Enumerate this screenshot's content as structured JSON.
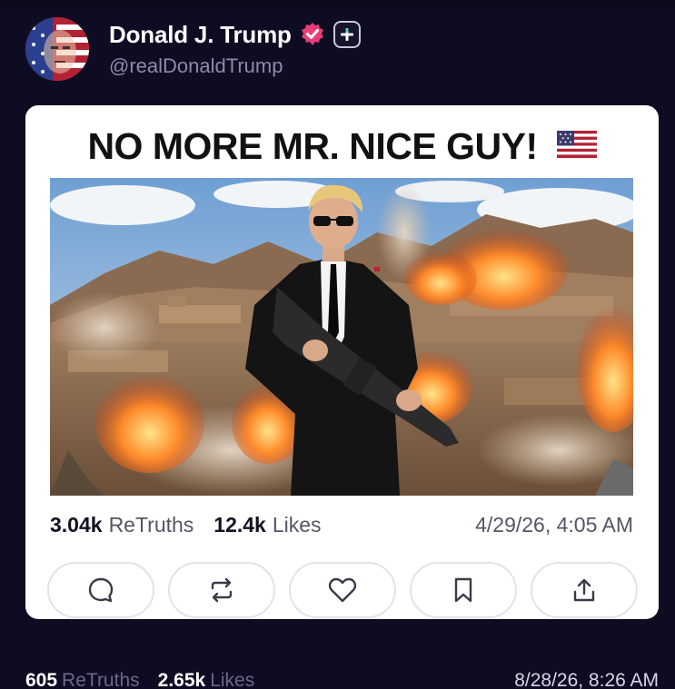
{
  "author": {
    "display_name": "Donald J. Trump",
    "handle": "@realDonaldTrump",
    "avatar_icon": "flag-face-avatar",
    "verified_icon": "verified-badge-icon",
    "follow_icon": "plus-icon"
  },
  "post": {
    "headline": "NO MORE MR. NICE GUY!",
    "headline_emoji": "us-flag-icon",
    "image_icon": "post-image",
    "retruths_count": "3.04k",
    "retruths_label": "ReTruths",
    "likes_count": "12.4k",
    "likes_label": "Likes",
    "timestamp": "4/29/26, 4:05 AM"
  },
  "actions": [
    {
      "name": "reply",
      "icon": "comment-icon"
    },
    {
      "name": "retruth",
      "icon": "repost-icon"
    },
    {
      "name": "like",
      "icon": "heart-icon"
    },
    {
      "name": "bookmark",
      "icon": "bookmark-icon"
    },
    {
      "name": "share",
      "icon": "share-icon"
    }
  ],
  "next_post": {
    "retruths_count": "605",
    "retruths_label": "ReTruths",
    "likes_count": "2.65k",
    "likes_label": "Likes",
    "timestamp": "8/28/26, 8:26 AM"
  },
  "colors": {
    "background": "#0d0c22",
    "card": "#ffffff",
    "verified": "#e83e75",
    "handle": "#8d8aa7"
  }
}
